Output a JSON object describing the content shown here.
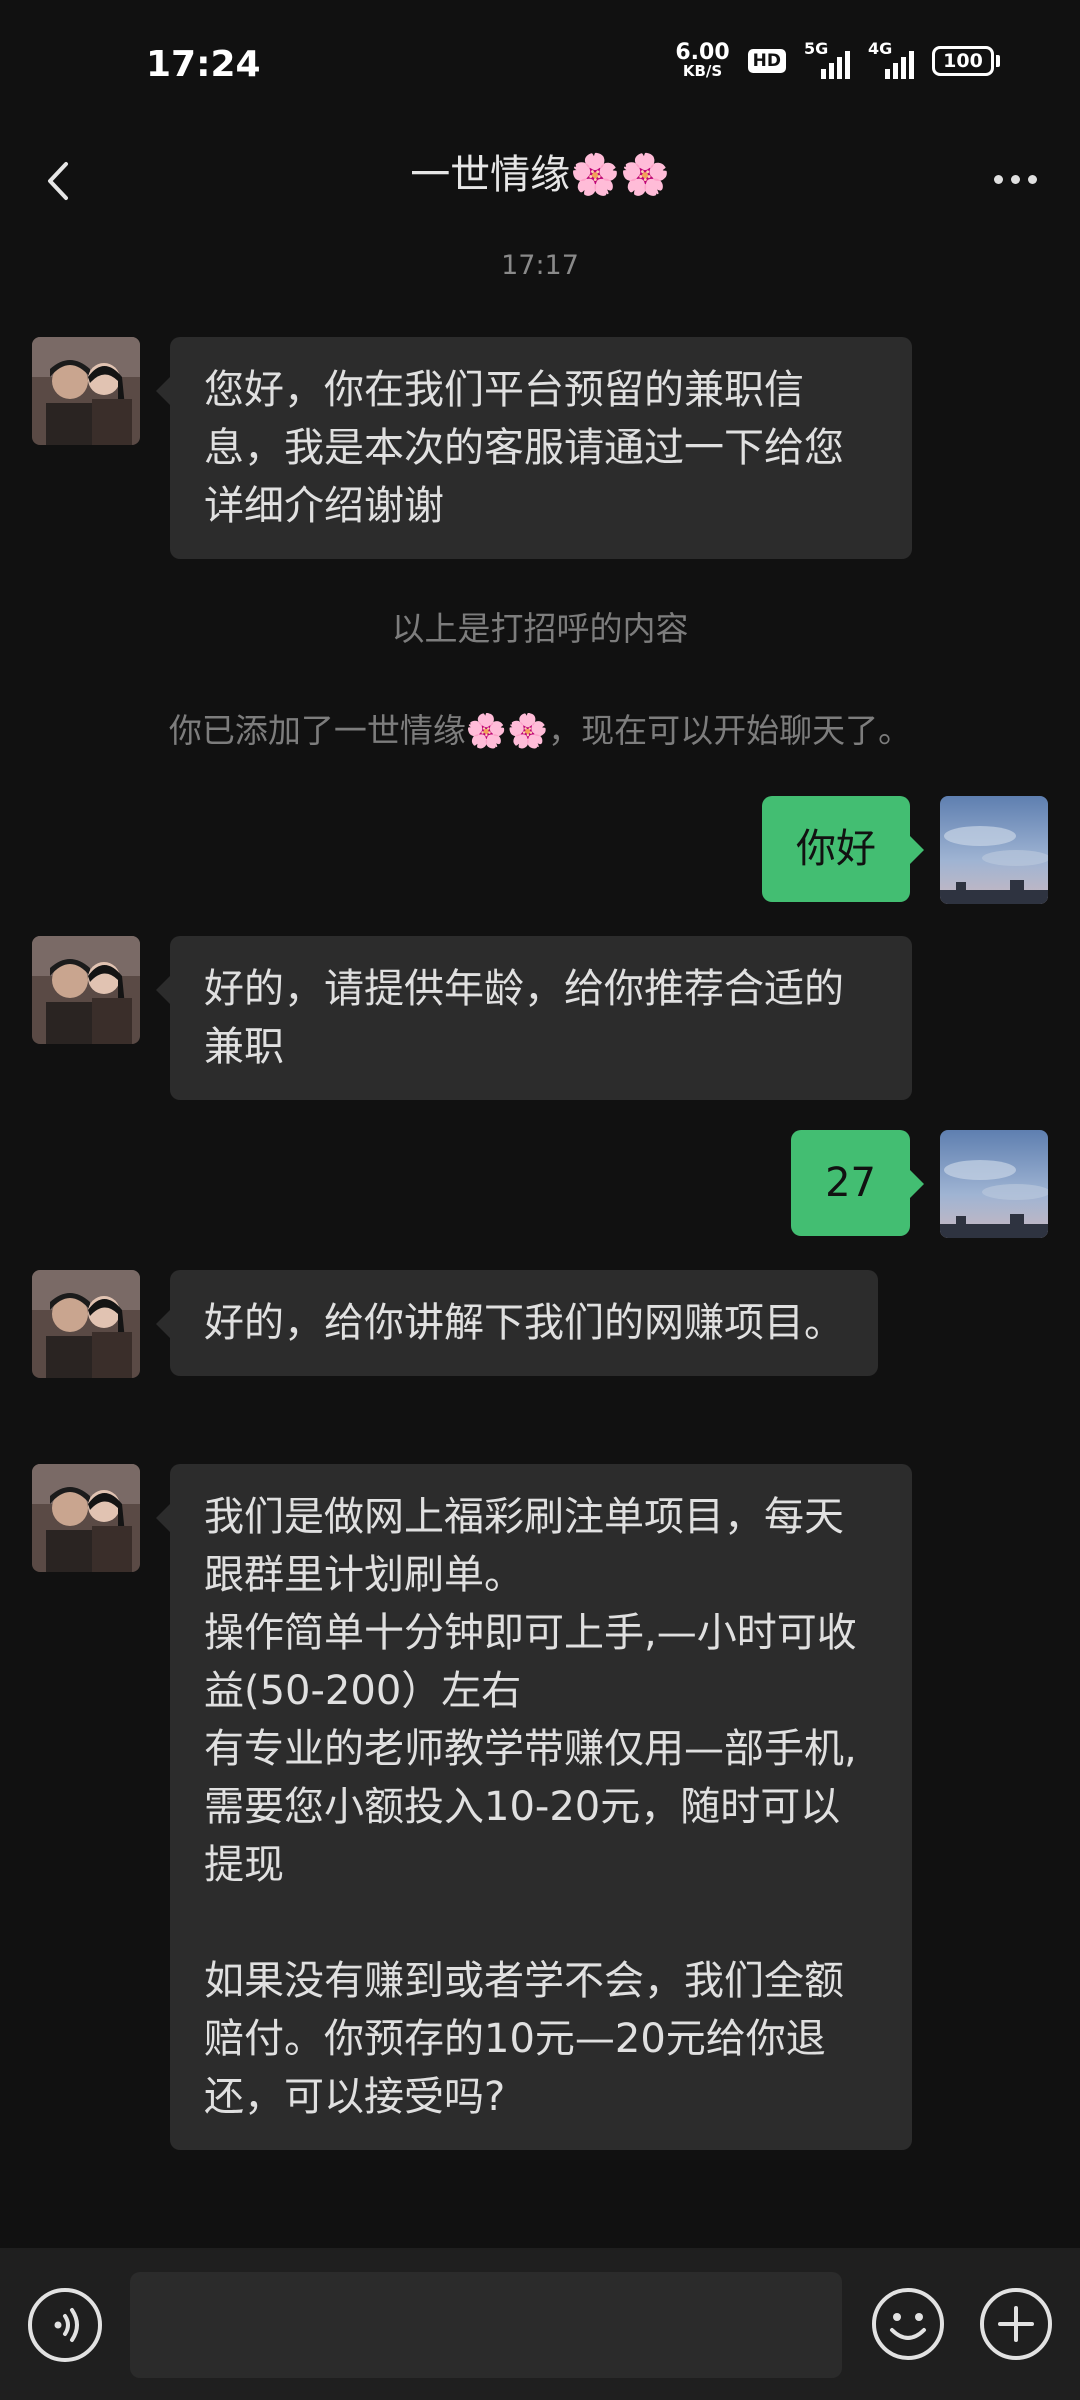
{
  "status_bar": {
    "time": "17:24",
    "net_speed_value": "6.00",
    "net_speed_unit": "KB/S",
    "hd_badge": "HD",
    "sim1_label": "5G",
    "sim2_label": "4G",
    "battery": "100"
  },
  "nav": {
    "title": "一世情缘🌸🌸",
    "back_icon": "chevron-left-icon",
    "more_icon": "more-horizontal-icon"
  },
  "chat": {
    "timestamp": "17:17",
    "msg1": "您好，你在我们平台预留的兼职信息，我是本次的客服请通过一下给您详细介绍谢谢",
    "greeting_note": "以上是打招呼的内容",
    "added_note": "你已添加了一世情缘🌸🌸，现在可以开始聊天了。",
    "msg2": "你好",
    "msg3": "好的，请提供年龄，给你推荐合适的兼职",
    "msg4": "27",
    "msg5": "好的，给你讲解下我们的网赚项目。",
    "msg6": "我们是做网上福彩刷注单项目，每天跟群里计划刷单。\n操作简单十分钟即可上手,—小时可收益(50-200）左右\n有专业的老师教学带赚仅用—部手机,\n需要您小额投入10-20元，随时可以提现\n\n如果没有赚到或者学不会，我们全额赔付。你预存的10元—20元给你退还，可以接受吗?"
  },
  "input_bar": {
    "voice_icon": "voice-icon",
    "emoji_icon": "emoji-icon",
    "plus_icon": "plus-circle-icon",
    "input_value": ""
  },
  "colors": {
    "background": "#111111",
    "incoming_bubble": "#2c2c2c",
    "outgoing_bubble": "#43be72"
  }
}
